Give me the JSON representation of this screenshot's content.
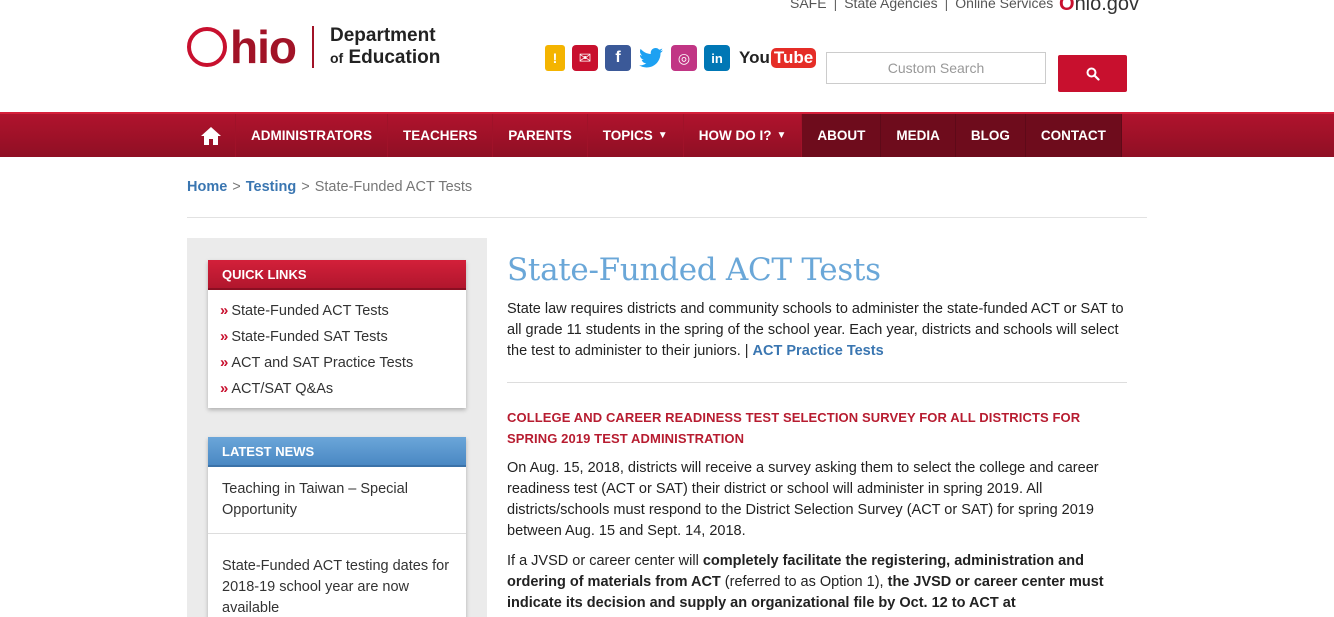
{
  "util_links": [
    "SAFE",
    "State Agencies",
    "Online Services"
  ],
  "util_sep": "|",
  "ohiogov": {
    "o": "O",
    "rest": "hio.gov"
  },
  "logo": {
    "word_rest": "hio",
    "dept_line1": "Department",
    "dept_of": "of",
    "dept_line2": "Education"
  },
  "social": [
    {
      "name": "alert-app-icon",
      "glyph": "!"
    },
    {
      "name": "email-icon",
      "glyph": "✉"
    },
    {
      "name": "facebook-icon",
      "glyph": "f"
    },
    {
      "name": "twitter-icon",
      "glyph": "🐦"
    },
    {
      "name": "instagram-icon",
      "glyph": "◎"
    },
    {
      "name": "linkedin-icon",
      "glyph": "in"
    },
    {
      "name": "youtube-icon",
      "glyph": "You",
      "glyph2": "Tube"
    }
  ],
  "search": {
    "placeholder": "Custom Search"
  },
  "nav": {
    "home_glyph": "⌂",
    "items": [
      "ADMINISTRATORS",
      "TEACHERS",
      "PARENTS",
      "TOPICS",
      "HOW DO I?",
      "ABOUT",
      "MEDIA",
      "BLOG",
      "CONTACT"
    ],
    "caret": "▼"
  },
  "breadcrumb": {
    "items": [
      "Home",
      "Testing"
    ],
    "current": "State-Funded ACT Tests",
    "sep": ">"
  },
  "sidebar": {
    "quick_links_title": "QUICK LINKS",
    "quick_links": [
      "State-Funded ACT Tests",
      "State-Funded SAT Tests",
      "ACT and SAT Practice Tests",
      "ACT/SAT Q&As"
    ],
    "bullet": "»",
    "latest_news_title": "LATEST NEWS",
    "news": [
      "Teaching in Taiwan – Special Opportunity",
      "State-Funded ACT testing dates for 2018-19 school year are now available"
    ]
  },
  "main": {
    "title": "State-Funded ACT Tests",
    "intro": "State law requires districts and community schools to administer the state-funded ACT or SAT to all grade 11 students in the spring of the school year. Each year, districts and schools will select the test to administer to their juniors. | ",
    "intro_link": "ACT Practice Tests",
    "section_heading": "COLLEGE AND CAREER READINESS TEST SELECTION SURVEY FOR ALL DISTRICTS FOR SPRING 2019 TEST ADMINISTRATION",
    "p2": "On Aug. 15, 2018, districts will receive a survey asking them to select the college and career readiness test (ACT or SAT) their district or school will administer in spring 2019. All districts/schools must respond to the District Selection Survey (ACT or SAT) for spring 2019 between Aug. 15 and Sept. 14, 2018.",
    "p3_a": "If a JVSD or career center will ",
    "p3_b": "completely facilitate the registering, administration and ordering of materials from ACT",
    "p3_c": " (referred to as Option 1), ",
    "p3_d": "the JVSD or career center must indicate its decision and supply an organizational file by Oct. 12 to ACT at"
  }
}
